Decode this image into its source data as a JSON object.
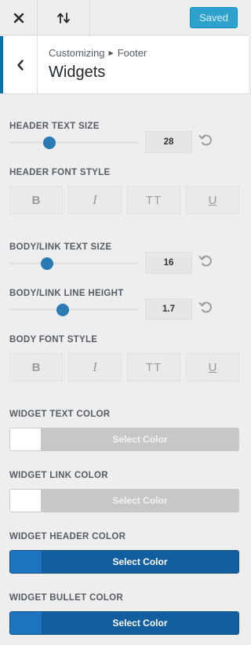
{
  "topbar": {
    "saved_label": "Saved"
  },
  "panel": {
    "breadcrumb_prefix": "Customizing",
    "breadcrumb_section": "Footer",
    "title": "Widgets"
  },
  "controls": {
    "header_text_size": {
      "label": "HEADER TEXT SIZE",
      "value": "28",
      "position": 0.31
    },
    "header_font_style": {
      "label": "HEADER FONT STYLE",
      "buttons": [
        "B",
        "I",
        "TT",
        "U"
      ]
    },
    "body_text_size": {
      "label": "BODY/LINK TEXT SIZE",
      "value": "16",
      "position": 0.29
    },
    "body_line_height": {
      "label": "BODY/LINK LINE HEIGHT",
      "value": "1.7",
      "position": 0.41
    },
    "body_font_style": {
      "label": "BODY FONT STYLE",
      "buttons": [
        "B",
        "I",
        "TT",
        "U"
      ]
    },
    "widget_text_color": {
      "label": "WIDGET TEXT COLOR",
      "button": "Select Color",
      "color": ""
    },
    "widget_link_color": {
      "label": "WIDGET LINK COLOR",
      "button": "Select Color",
      "color": ""
    },
    "widget_header_color": {
      "label": "WIDGET HEADER COLOR",
      "button": "Select Color",
      "color": "#1e73be"
    },
    "widget_bullet_color": {
      "label": "WIDGET BULLET COLOR",
      "button": "Select Color",
      "color": "#1e73be"
    }
  },
  "icons": {
    "close": "close-icon",
    "sort": "sort-arrows-icon",
    "back": "chevron-left-icon",
    "reset": "undo-icon"
  },
  "colors": {
    "accent": "#2ea2cc",
    "slider": "#2a7ab5",
    "nav_border": "#0073aa"
  }
}
